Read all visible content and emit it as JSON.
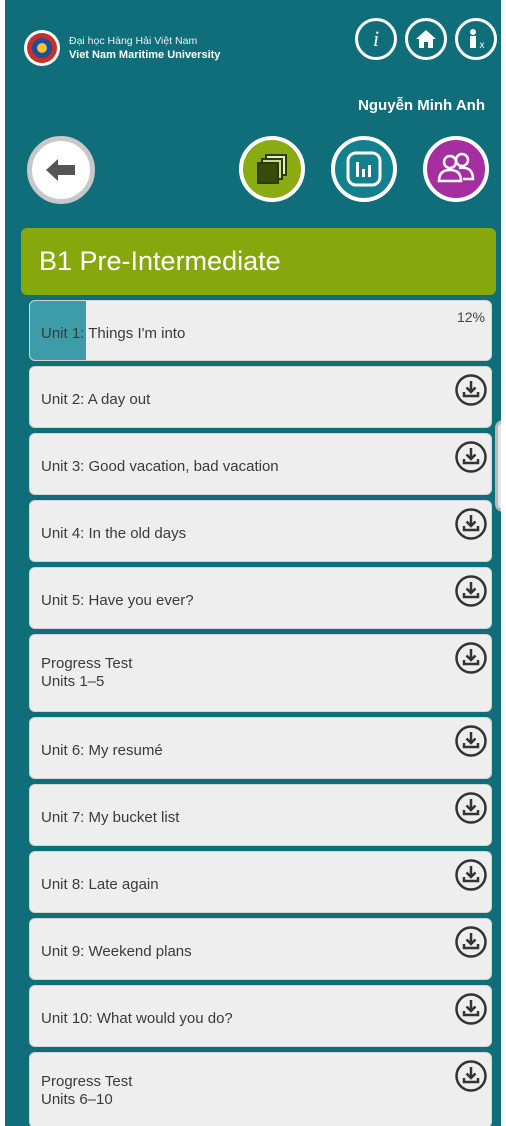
{
  "header": {
    "university_vi": "Đại học Hàng Hải Việt Nam",
    "university_en": "Viet Nam Maritime University",
    "user_name": "Nguyễn Minh Anh",
    "top_icons": [
      "info-icon",
      "home-icon",
      "user-info-icon"
    ]
  },
  "nav": {
    "buttons": [
      "back-arrow-icon",
      "units-stack-icon",
      "statistics-chart-icon",
      "people-group-icon"
    ]
  },
  "level": {
    "title": "B1 Pre-Intermediate"
  },
  "units": [
    {
      "label": "Unit 1: Things I'm into",
      "progress": "12%",
      "progress_fraction": 0.12
    },
    {
      "label": "Unit 2: A day out"
    },
    {
      "label": "Unit 3: Good vacation, bad vacation"
    },
    {
      "label": "Unit 4: In the old days"
    },
    {
      "label": "Unit 5: Have you ever?"
    },
    {
      "label": "Progress Test\nUnits 1–5"
    },
    {
      "label": "Unit 6: My resumé"
    },
    {
      "label": "Unit 7: My bucket list"
    },
    {
      "label": "Unit 8: Late again"
    },
    {
      "label": "Unit 9: Weekend plans"
    },
    {
      "label": "Unit 10: What would you do?"
    },
    {
      "label": "Progress Test\nUnits 6–10"
    }
  ],
  "colors": {
    "background": "#0f6e7a",
    "level_bar": "#87a80c",
    "units_button": "#8bab12",
    "stats_button": "#15808d",
    "people_button": "#a52fa1",
    "progress_fill": "#3d9ca7"
  }
}
